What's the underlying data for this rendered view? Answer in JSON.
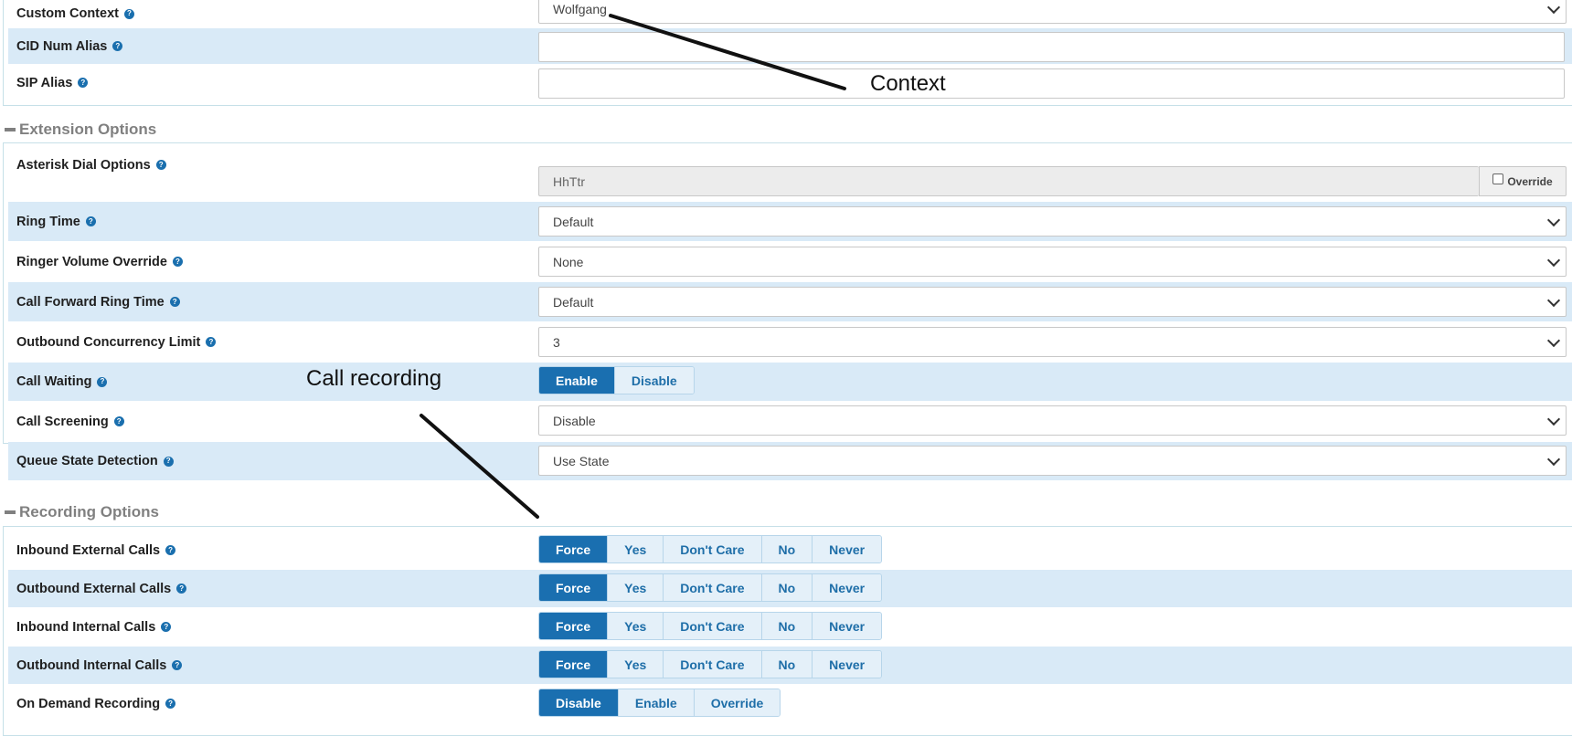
{
  "general": {
    "rows": [
      {
        "label": "Custom Context",
        "value": "Wolfgang"
      },
      {
        "label": "CID Num Alias",
        "value": ""
      },
      {
        "label": "SIP Alias",
        "value": ""
      }
    ]
  },
  "extension_options": {
    "title": "Extension Options",
    "asterisk_dial_options": {
      "label": "Asterisk Dial Options",
      "value": "HhTtr",
      "override_label": "Override"
    },
    "ring_time": {
      "label": "Ring Time",
      "value": "Default"
    },
    "ringer_volume_override": {
      "label": "Ringer Volume Override",
      "value": "None"
    },
    "call_forward_ring_time": {
      "label": "Call Forward Ring Time",
      "value": "Default"
    },
    "outbound_concurrency_limit": {
      "label": "Outbound Concurrency Limit",
      "value": "3"
    },
    "call_waiting": {
      "label": "Call Waiting",
      "options": [
        "Enable",
        "Disable"
      ],
      "selected": "Enable"
    },
    "call_screening": {
      "label": "Call Screening",
      "value": "Disable"
    },
    "queue_state_detection": {
      "label": "Queue State Detection",
      "value": "Use State"
    }
  },
  "recording_options": {
    "title": "Recording Options",
    "record_choices": [
      "Force",
      "Yes",
      "Don't Care",
      "No",
      "Never"
    ],
    "rows": [
      {
        "label": "Inbound External Calls",
        "selected": "Force"
      },
      {
        "label": "Outbound External Calls",
        "selected": "Force"
      },
      {
        "label": "Inbound Internal Calls",
        "selected": "Force"
      },
      {
        "label": "Outbound Internal Calls",
        "selected": "Force"
      }
    ],
    "on_demand": {
      "label": "On Demand Recording",
      "options": [
        "Disable",
        "Enable",
        "Override"
      ],
      "selected": "Disable"
    }
  },
  "annotations": {
    "context": "Context",
    "call_recording": "Call recording",
    "line_color": "#111111"
  },
  "colors": {
    "accent": "#1a6fb0",
    "row_shade": "#d9eaf7",
    "section_title": "#808080"
  },
  "icons": {
    "help": "question-circle-icon",
    "select": "chevron-down-icon"
  }
}
